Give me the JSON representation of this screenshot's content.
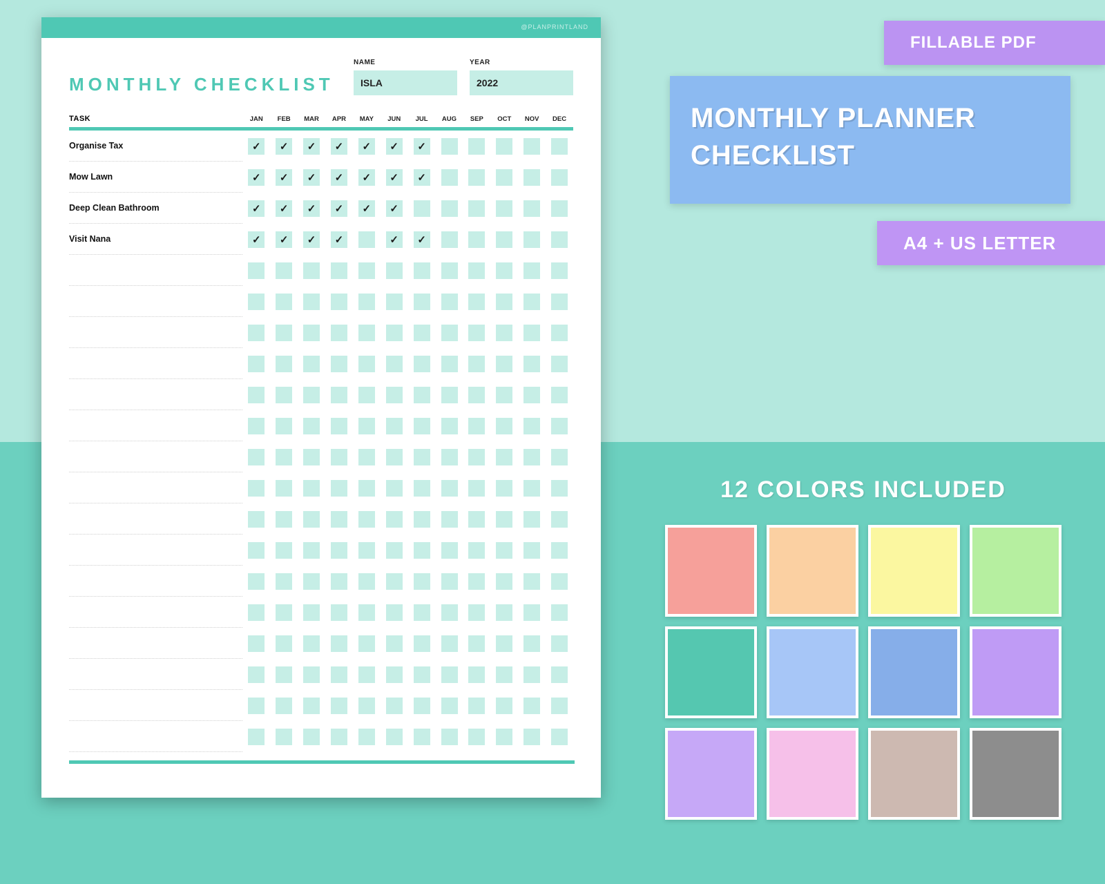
{
  "sheet": {
    "brand": "@PLANPRINTLAND",
    "title": "MONTHLY CHECKLIST",
    "name_label": "NAME",
    "name_value": "ISLA",
    "year_label": "YEAR",
    "year_value": "2022",
    "task_header": "TASK",
    "months": [
      "JAN",
      "FEB",
      "MAR",
      "APR",
      "MAY",
      "JUN",
      "JUL",
      "AUG",
      "SEP",
      "OCT",
      "NOV",
      "DEC"
    ],
    "rows": [
      {
        "task": "Organise Tax",
        "checks": [
          true,
          true,
          true,
          true,
          true,
          true,
          true,
          false,
          false,
          false,
          false,
          false
        ]
      },
      {
        "task": "Mow Lawn",
        "checks": [
          true,
          true,
          true,
          true,
          true,
          true,
          true,
          false,
          false,
          false,
          false,
          false
        ]
      },
      {
        "task": "Deep Clean Bathroom",
        "checks": [
          true,
          true,
          true,
          true,
          true,
          true,
          false,
          false,
          false,
          false,
          false,
          false
        ]
      },
      {
        "task": "Visit Nana",
        "checks": [
          true,
          true,
          true,
          true,
          false,
          true,
          true,
          false,
          false,
          false,
          false,
          false
        ]
      },
      {
        "task": "",
        "checks": [
          false,
          false,
          false,
          false,
          false,
          false,
          false,
          false,
          false,
          false,
          false,
          false
        ]
      },
      {
        "task": "",
        "checks": [
          false,
          false,
          false,
          false,
          false,
          false,
          false,
          false,
          false,
          false,
          false,
          false
        ]
      },
      {
        "task": "",
        "checks": [
          false,
          false,
          false,
          false,
          false,
          false,
          false,
          false,
          false,
          false,
          false,
          false
        ]
      },
      {
        "task": "",
        "checks": [
          false,
          false,
          false,
          false,
          false,
          false,
          false,
          false,
          false,
          false,
          false,
          false
        ]
      },
      {
        "task": "",
        "checks": [
          false,
          false,
          false,
          false,
          false,
          false,
          false,
          false,
          false,
          false,
          false,
          false
        ]
      },
      {
        "task": "",
        "checks": [
          false,
          false,
          false,
          false,
          false,
          false,
          false,
          false,
          false,
          false,
          false,
          false
        ]
      },
      {
        "task": "",
        "checks": [
          false,
          false,
          false,
          false,
          false,
          false,
          false,
          false,
          false,
          false,
          false,
          false
        ]
      },
      {
        "task": "",
        "checks": [
          false,
          false,
          false,
          false,
          false,
          false,
          false,
          false,
          false,
          false,
          false,
          false
        ]
      },
      {
        "task": "",
        "checks": [
          false,
          false,
          false,
          false,
          false,
          false,
          false,
          false,
          false,
          false,
          false,
          false
        ]
      },
      {
        "task": "",
        "checks": [
          false,
          false,
          false,
          false,
          false,
          false,
          false,
          false,
          false,
          false,
          false,
          false
        ]
      },
      {
        "task": "",
        "checks": [
          false,
          false,
          false,
          false,
          false,
          false,
          false,
          false,
          false,
          false,
          false,
          false
        ]
      },
      {
        "task": "",
        "checks": [
          false,
          false,
          false,
          false,
          false,
          false,
          false,
          false,
          false,
          false,
          false,
          false
        ]
      },
      {
        "task": "",
        "checks": [
          false,
          false,
          false,
          false,
          false,
          false,
          false,
          false,
          false,
          false,
          false,
          false
        ]
      },
      {
        "task": "",
        "checks": [
          false,
          false,
          false,
          false,
          false,
          false,
          false,
          false,
          false,
          false,
          false,
          false
        ]
      },
      {
        "task": "",
        "checks": [
          false,
          false,
          false,
          false,
          false,
          false,
          false,
          false,
          false,
          false,
          false,
          false
        ]
      },
      {
        "task": "",
        "checks": [
          false,
          false,
          false,
          false,
          false,
          false,
          false,
          false,
          false,
          false,
          false,
          false
        ]
      }
    ]
  },
  "promo": {
    "fillable": "FILLABLE PDF",
    "title_line1": "MONTHLY PLANNER",
    "title_line2": "CHECKLIST",
    "size": "A4 + US LETTER",
    "colors_heading": "12 COLORS INCLUDED",
    "swatches": [
      "#f6a09a",
      "#fbd0a2",
      "#fbf7a0",
      "#b6efa0",
      "#55c7b0",
      "#a7c6f7",
      "#86aee9",
      "#bf9bf5",
      "#c6a8f7",
      "#f6c0e9",
      "#cdb9b1",
      "#8d8d8d"
    ]
  }
}
